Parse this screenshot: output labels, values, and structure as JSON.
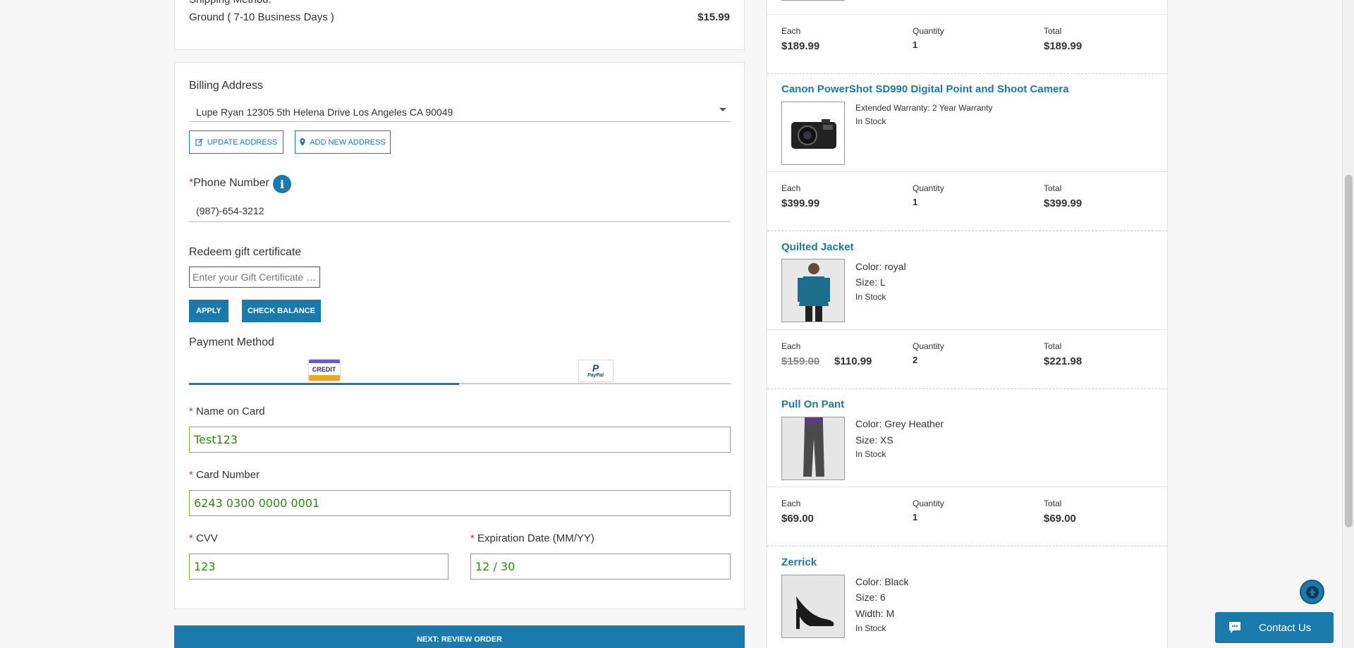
{
  "shipping": {
    "label": "Shipping Method:",
    "method": "Ground ( 7-10 Business Days )",
    "price": "$15.99"
  },
  "billing": {
    "title": "Billing Address",
    "selected_address": "Lupe Ryan 12305 5th Helena Drive Los Angeles CA 90049",
    "update_label": "UPDATE ADDRESS",
    "add_label": "ADD NEW ADDRESS"
  },
  "phone": {
    "required_mark": "*",
    "label": "Phone Number",
    "info_glyph": "i",
    "value": "(987)-654-3212"
  },
  "gift": {
    "label": "Redeem gift certificate",
    "placeholder": "Enter your Gift Certificate Code",
    "apply_label": "APPLY",
    "check_label": "CHECK BALANCE"
  },
  "payment": {
    "title": "Payment Method",
    "tabs": [
      {
        "label": "CREDIT",
        "active": true,
        "icon": "credit-card-icon"
      },
      {
        "label": "PayPal",
        "active": false,
        "icon": "paypal-icon"
      }
    ],
    "name_label": "Name on Card",
    "name_value": "Test123",
    "card_label": "Card Number",
    "card_value": "6243 0300 0000 0001",
    "cvv_label": "CVV",
    "cvv_value": "123",
    "exp_label": "Expiration Date (MM/YY)",
    "exp_value": "12 / 30",
    "required_mark": "*"
  },
  "next_button": "NEXT: REVIEW ORDER",
  "cart": {
    "labels": {
      "each": "Each",
      "quantity": "Quantity",
      "total": "Total"
    },
    "row0": {
      "each": "$189.99",
      "quantity": "1",
      "total": "$189.99"
    },
    "items": [
      {
        "name": "Canon PowerShot SD990 Digital Point and Shoot Camera",
        "attr1": "Extended Warranty: 2 Year Warranty",
        "stock": "In Stock",
        "each": "$399.99",
        "quantity": "1",
        "total": "$399.99"
      },
      {
        "name": "Quilted Jacket",
        "attr1": "Color: royal",
        "attr2": "Size: L",
        "stock": "In Stock",
        "each_old": "$159.00",
        "each": "$110.99",
        "quantity": "2",
        "total": "$221.98"
      },
      {
        "name": "Pull On Pant",
        "attr1": "Color: Grey Heather",
        "attr2": "Size: XS",
        "stock": "In Stock",
        "each": "$69.00",
        "quantity": "1",
        "total": "$69.00"
      },
      {
        "name": "Zerrick",
        "attr1": "Color: Black",
        "attr2": "Size: 6",
        "attr3": "Width: M",
        "stock": "In Stock"
      }
    ]
  },
  "contact_label": "Contact Us",
  "colors": {
    "accent": "#1a7aab",
    "valid_border": "#7cbf22",
    "valid_text": "#2e8b12"
  }
}
